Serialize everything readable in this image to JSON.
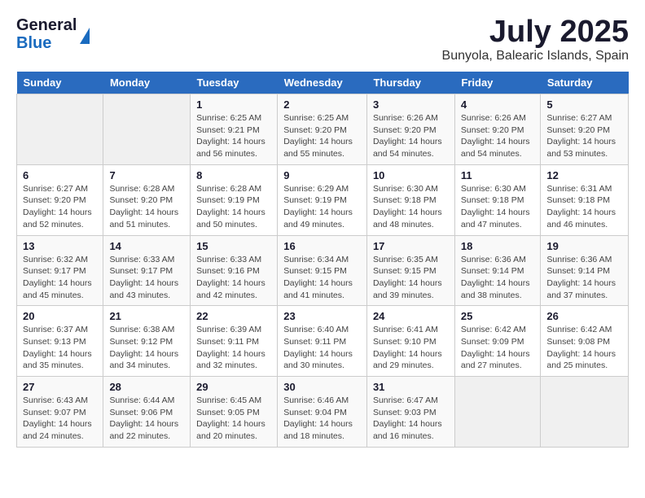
{
  "header": {
    "logo_general": "General",
    "logo_blue": "Blue",
    "month_title": "July 2025",
    "location": "Bunyola, Balearic Islands, Spain"
  },
  "calendar": {
    "days_of_week": [
      "Sunday",
      "Monday",
      "Tuesday",
      "Wednesday",
      "Thursday",
      "Friday",
      "Saturday"
    ],
    "weeks": [
      [
        {
          "day": "",
          "info": ""
        },
        {
          "day": "",
          "info": ""
        },
        {
          "day": "1",
          "info": "Sunrise: 6:25 AM\nSunset: 9:21 PM\nDaylight: 14 hours and 56 minutes."
        },
        {
          "day": "2",
          "info": "Sunrise: 6:25 AM\nSunset: 9:20 PM\nDaylight: 14 hours and 55 minutes."
        },
        {
          "day": "3",
          "info": "Sunrise: 6:26 AM\nSunset: 9:20 PM\nDaylight: 14 hours and 54 minutes."
        },
        {
          "day": "4",
          "info": "Sunrise: 6:26 AM\nSunset: 9:20 PM\nDaylight: 14 hours and 54 minutes."
        },
        {
          "day": "5",
          "info": "Sunrise: 6:27 AM\nSunset: 9:20 PM\nDaylight: 14 hours and 53 minutes."
        }
      ],
      [
        {
          "day": "6",
          "info": "Sunrise: 6:27 AM\nSunset: 9:20 PM\nDaylight: 14 hours and 52 minutes."
        },
        {
          "day": "7",
          "info": "Sunrise: 6:28 AM\nSunset: 9:20 PM\nDaylight: 14 hours and 51 minutes."
        },
        {
          "day": "8",
          "info": "Sunrise: 6:28 AM\nSunset: 9:19 PM\nDaylight: 14 hours and 50 minutes."
        },
        {
          "day": "9",
          "info": "Sunrise: 6:29 AM\nSunset: 9:19 PM\nDaylight: 14 hours and 49 minutes."
        },
        {
          "day": "10",
          "info": "Sunrise: 6:30 AM\nSunset: 9:18 PM\nDaylight: 14 hours and 48 minutes."
        },
        {
          "day": "11",
          "info": "Sunrise: 6:30 AM\nSunset: 9:18 PM\nDaylight: 14 hours and 47 minutes."
        },
        {
          "day": "12",
          "info": "Sunrise: 6:31 AM\nSunset: 9:18 PM\nDaylight: 14 hours and 46 minutes."
        }
      ],
      [
        {
          "day": "13",
          "info": "Sunrise: 6:32 AM\nSunset: 9:17 PM\nDaylight: 14 hours and 45 minutes."
        },
        {
          "day": "14",
          "info": "Sunrise: 6:33 AM\nSunset: 9:17 PM\nDaylight: 14 hours and 43 minutes."
        },
        {
          "day": "15",
          "info": "Sunrise: 6:33 AM\nSunset: 9:16 PM\nDaylight: 14 hours and 42 minutes."
        },
        {
          "day": "16",
          "info": "Sunrise: 6:34 AM\nSunset: 9:15 PM\nDaylight: 14 hours and 41 minutes."
        },
        {
          "day": "17",
          "info": "Sunrise: 6:35 AM\nSunset: 9:15 PM\nDaylight: 14 hours and 39 minutes."
        },
        {
          "day": "18",
          "info": "Sunrise: 6:36 AM\nSunset: 9:14 PM\nDaylight: 14 hours and 38 minutes."
        },
        {
          "day": "19",
          "info": "Sunrise: 6:36 AM\nSunset: 9:14 PM\nDaylight: 14 hours and 37 minutes."
        }
      ],
      [
        {
          "day": "20",
          "info": "Sunrise: 6:37 AM\nSunset: 9:13 PM\nDaylight: 14 hours and 35 minutes."
        },
        {
          "day": "21",
          "info": "Sunrise: 6:38 AM\nSunset: 9:12 PM\nDaylight: 14 hours and 34 minutes."
        },
        {
          "day": "22",
          "info": "Sunrise: 6:39 AM\nSunset: 9:11 PM\nDaylight: 14 hours and 32 minutes."
        },
        {
          "day": "23",
          "info": "Sunrise: 6:40 AM\nSunset: 9:11 PM\nDaylight: 14 hours and 30 minutes."
        },
        {
          "day": "24",
          "info": "Sunrise: 6:41 AM\nSunset: 9:10 PM\nDaylight: 14 hours and 29 minutes."
        },
        {
          "day": "25",
          "info": "Sunrise: 6:42 AM\nSunset: 9:09 PM\nDaylight: 14 hours and 27 minutes."
        },
        {
          "day": "26",
          "info": "Sunrise: 6:42 AM\nSunset: 9:08 PM\nDaylight: 14 hours and 25 minutes."
        }
      ],
      [
        {
          "day": "27",
          "info": "Sunrise: 6:43 AM\nSunset: 9:07 PM\nDaylight: 14 hours and 24 minutes."
        },
        {
          "day": "28",
          "info": "Sunrise: 6:44 AM\nSunset: 9:06 PM\nDaylight: 14 hours and 22 minutes."
        },
        {
          "day": "29",
          "info": "Sunrise: 6:45 AM\nSunset: 9:05 PM\nDaylight: 14 hours and 20 minutes."
        },
        {
          "day": "30",
          "info": "Sunrise: 6:46 AM\nSunset: 9:04 PM\nDaylight: 14 hours and 18 minutes."
        },
        {
          "day": "31",
          "info": "Sunrise: 6:47 AM\nSunset: 9:03 PM\nDaylight: 14 hours and 16 minutes."
        },
        {
          "day": "",
          "info": ""
        },
        {
          "day": "",
          "info": ""
        }
      ]
    ]
  }
}
